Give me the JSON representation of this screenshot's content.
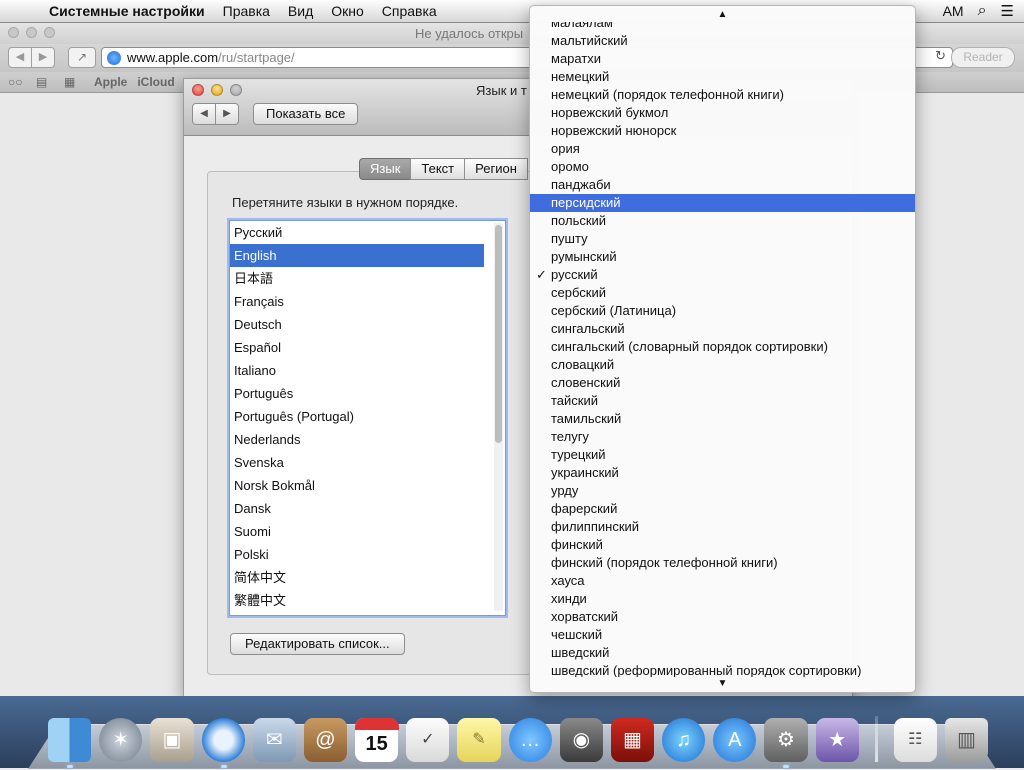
{
  "menubar": {
    "apple": "",
    "app": "Системные настройки",
    "items": [
      "Правка",
      "Вид",
      "Окно",
      "Справка"
    ],
    "clock": "AM"
  },
  "safari": {
    "title": "Не удалось откры",
    "url_host": "www.apple.com",
    "url_path": "/ru/startpage/",
    "reader": "Reader",
    "bookmarks": [
      "Apple",
      "iCloud"
    ]
  },
  "prefs": {
    "title": "Язык и т",
    "show_all": "Показать все",
    "tabs": [
      "Язык",
      "Текст",
      "Регион"
    ],
    "instruction": "Перетяните языки в нужном порядке.",
    "languages": [
      "Русский",
      "English",
      "日本語",
      "Français",
      "Deutsch",
      "Español",
      "Italiano",
      "Português",
      "Português (Portugal)",
      "Nederlands",
      "Svenska",
      "Norsk Bokmål",
      "Dansk",
      "Suomi",
      "Polski",
      "简体中文",
      "繁體中文"
    ],
    "selected_language_index": 1,
    "edit_button": "Редактировать список..."
  },
  "popup": {
    "items": [
      "малаялам",
      "мальтийский",
      "маратхи",
      "немецкий",
      "немецкий (порядок телефонной книги)",
      "норвежский букмол",
      "норвежский нюнорск",
      "ория",
      "оромо",
      "панджаби",
      "персидский",
      "польский",
      "пушту",
      "румынский",
      "русский",
      "сербский",
      "сербский (Латиница)",
      "сингальский",
      "сингальский (словарный порядок сортировки)",
      "словацкий",
      "словенский",
      "тайский",
      "тамильский",
      "телугу",
      "турецкий",
      "украинский",
      "урду",
      "фарерский",
      "филиппинский",
      "финский",
      "финский (порядок телефонной книги)",
      "хауса",
      "хинди",
      "хорватский",
      "чешский",
      "шведский",
      "шведский (реформированный порядок сортировки)"
    ],
    "highlighted_index": 10,
    "checked_index": 14,
    "check_mark": "✓",
    "scroll_up": "▲",
    "scroll_down": "▼"
  },
  "dock": {
    "calendar_day": "15",
    "icons": [
      "finder-icon",
      "launchpad-icon",
      "photo-browser-icon",
      "safari-icon",
      "mail-icon",
      "contacts-icon",
      "calendar-icon",
      "reminders-icon",
      "notes-icon",
      "messages-icon",
      "facetime-icon",
      "photo-booth-icon",
      "itunes-icon",
      "app-store-icon",
      "system-preferences-icon",
      "wizard-icon",
      "document-icon",
      "trash-icon"
    ]
  }
}
